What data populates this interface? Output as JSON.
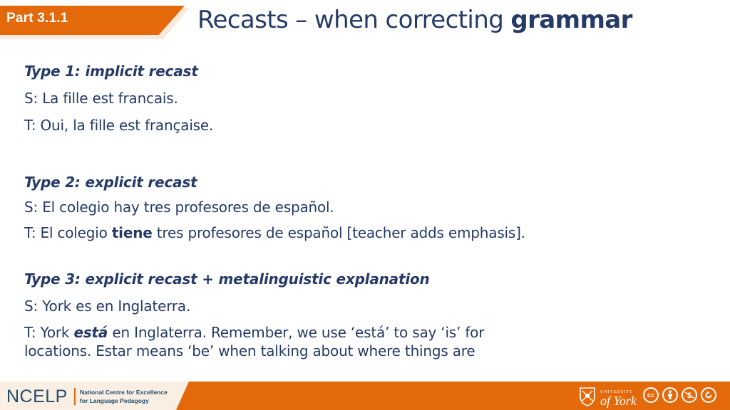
{
  "header": {
    "section_label": "Part 3.1.1",
    "title_prefix": "Recasts – when correcting ",
    "title_emphasis": "grammar"
  },
  "sections": [
    {
      "heading": "Type 1: implicit recast",
      "student": "S: La fille est francais.",
      "teacher": {
        "before": "T: Oui, la fille est française.",
        "emphasis": "",
        "after": ""
      }
    },
    {
      "heading": "Type 2: explicit recast",
      "student": "S: El colegio hay tres profesores de español.",
      "teacher": {
        "before": "T: El colegio ",
        "emphasis": "tiene",
        "after": " tres profesores de español [teacher adds emphasis]."
      }
    },
    {
      "heading": "Type 3: explicit recast + metalinguistic explanation",
      "student": "S: York es en Inglaterra.",
      "teacher": {
        "before": "T: York ",
        "emphasis": "está",
        "after": " en Inglaterra. Remember, we use ‘está’ to say ‘is’ for",
        "continuation": "locations. Estar means ‘be’ when talking about where things are"
      }
    }
  ],
  "footer": {
    "org_logo": "NCELP",
    "org_name_line1": "National Centre for Excellence",
    "org_name_line2": "for Language Pedagogy",
    "university_line1": "UNIVERSITY",
    "university_line2": "of York",
    "license_icons": [
      "cc-icon",
      "by-attribution-icon",
      "nc-noncommercial-icon",
      "sa-sharealike-icon"
    ],
    "license_labels": [
      "cc",
      "",
      "",
      ""
    ]
  },
  "colors": {
    "accent_orange": "#e3690b",
    "text_navy": "#253a66",
    "cream": "#fbeee3",
    "ncelp_blue": "#1f4e6e"
  }
}
